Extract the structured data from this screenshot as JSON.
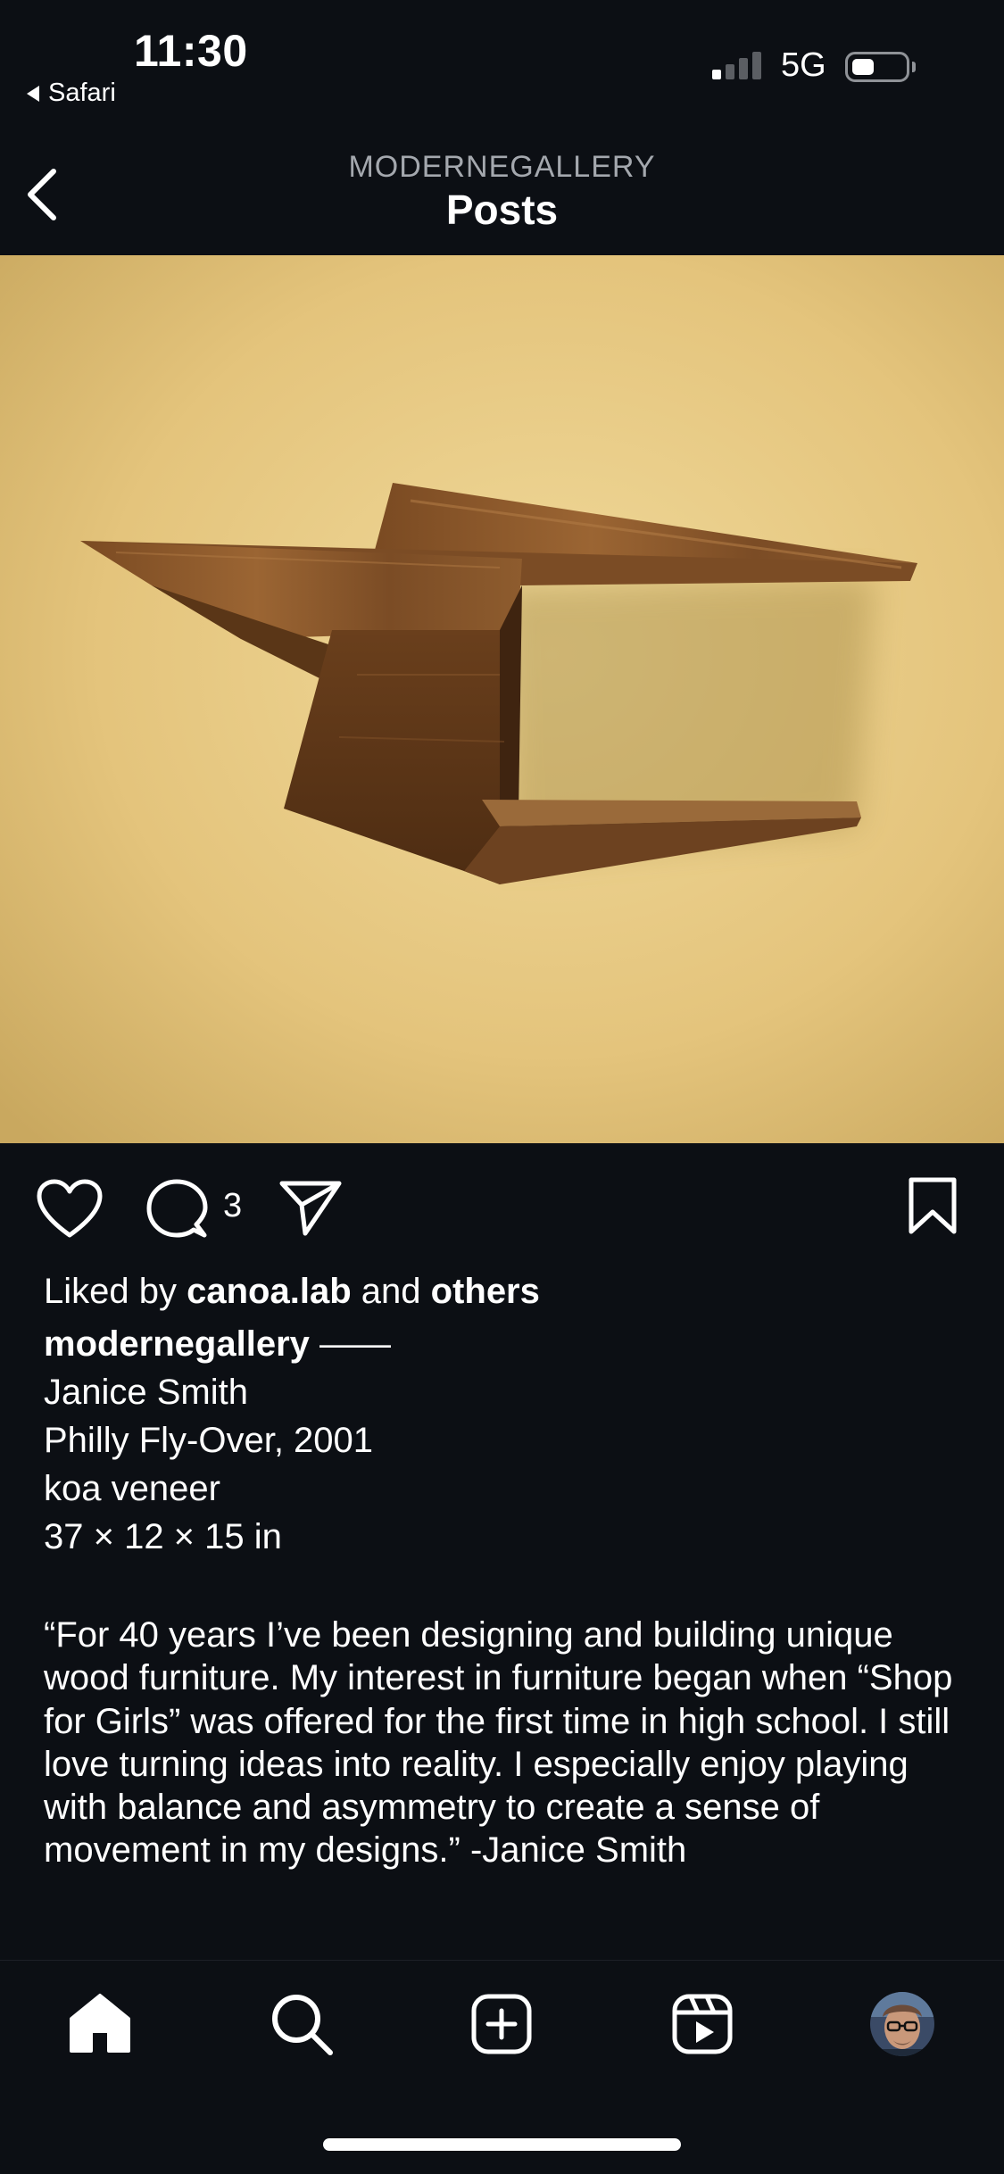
{
  "status_bar": {
    "time": "11:30",
    "back_app": "Safari",
    "network": "5G",
    "signal_bars_active": 1,
    "signal_bars_total": 4,
    "battery_level": 0.3
  },
  "header": {
    "account": "MODERNEGALLERY",
    "title": "Posts",
    "back_icon": "chevron-left-icon"
  },
  "post": {
    "image_icon": "photo-wall-shelf",
    "actions": {
      "like_icon": "heart-icon",
      "comment_icon": "comment-icon",
      "comment_count": "3",
      "share_icon": "send-icon",
      "save_icon": "bookmark-icon"
    },
    "liked_by": {
      "prefix": "Liked by",
      "user": "canoa.lab",
      "middle": "and",
      "suffix": "others"
    },
    "caption": {
      "username": "modernegallery",
      "dash": "——",
      "artist": "Janice Smith",
      "title": "Philly Fly-Over, 2001",
      "material": "koa veneer",
      "dimensions": "37 × 12 × 15 in",
      "quote": "“For 40 years I’ve been designing and building unique wood furniture. My interest in furniture began when “Shop for Girls” was offered for the first time in high school. I still love turning ideas into reality. I especially enjoy playing with balance and asymmetry to create a sense of movement in my designs.” -Janice Smith"
    }
  },
  "tab_bar": [
    {
      "name": "home",
      "icon": "home-icon",
      "active": true
    },
    {
      "name": "search",
      "icon": "search-icon",
      "active": false
    },
    {
      "name": "create",
      "icon": "add-post-icon",
      "active": false
    },
    {
      "name": "reels",
      "icon": "reels-icon",
      "active": false
    },
    {
      "name": "profile",
      "icon": "avatar",
      "active": false
    }
  ],
  "colors": {
    "background": "#0c0f14",
    "text": "#ffffff",
    "muted": "#a4a8ae"
  }
}
